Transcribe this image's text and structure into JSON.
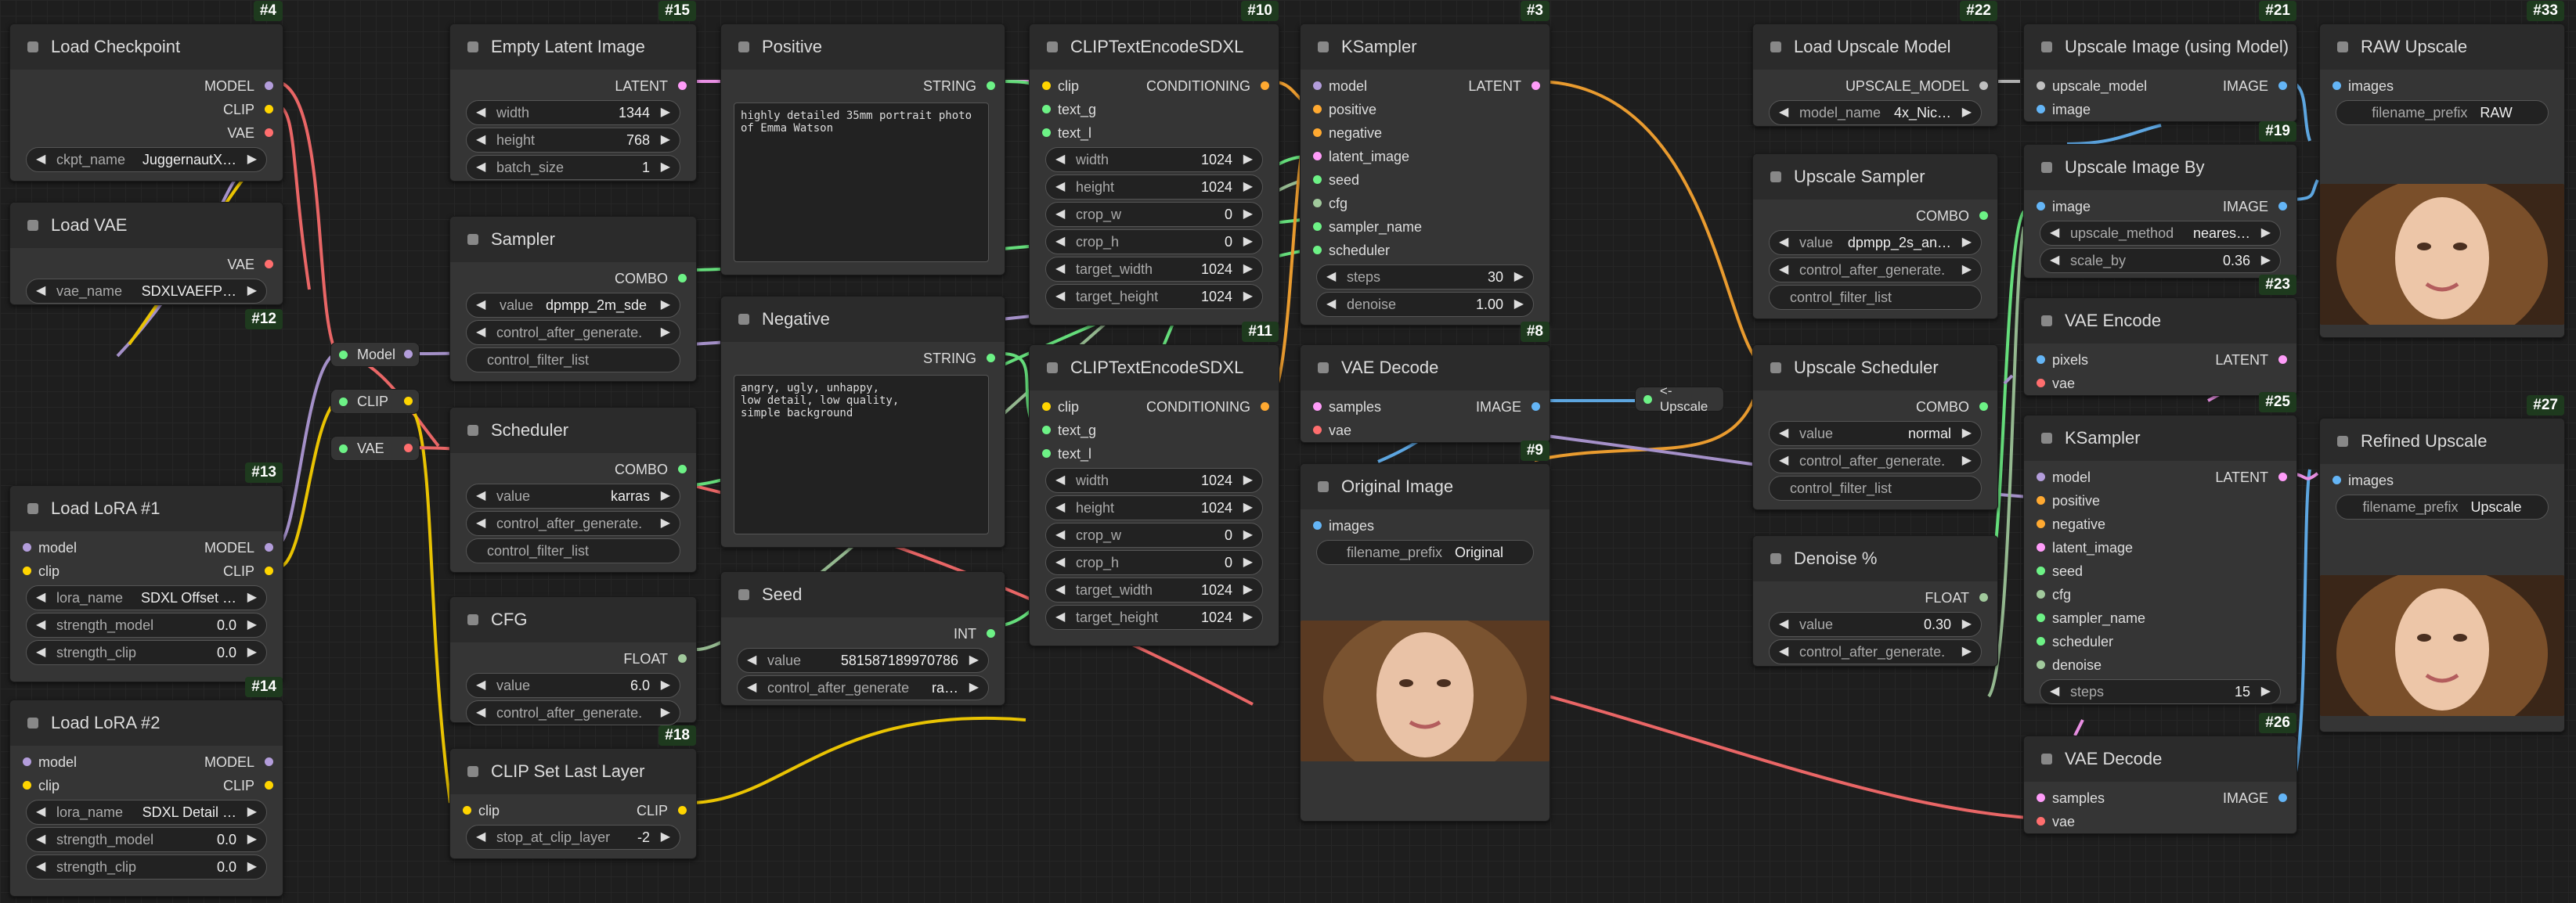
{
  "colors": {
    "model": "#b39ddb",
    "clip": "#ffd500",
    "vae": "#ff6e6e",
    "latent": "#ff9cf9",
    "conditioning": "#ffa931",
    "image": "#64b5f6",
    "string": "#6df286",
    "int": "#6df286",
    "float": "#a1c99c",
    "combo": "#6df286",
    "upscale": "#c0c0c0"
  },
  "nodes": {
    "n4": {
      "title": "Load Checkpoint",
      "id": "#4",
      "out": [
        "MODEL",
        "CLIP",
        "VAE"
      ],
      "w": {
        "label": "ckpt_name",
        "value": "JuggernautX…"
      }
    },
    "n12": {
      "title": "Load VAE",
      "id": "#12",
      "out": [
        "VAE"
      ],
      "w": {
        "label": "vae_name",
        "value": "SDXLVAEFP…"
      }
    },
    "n13": {
      "title": "Load LoRA #1",
      "id": "#13",
      "in": [
        "model",
        "clip"
      ],
      "out": [
        "MODEL",
        "CLIP"
      ],
      "w": [
        {
          "label": "lora_name",
          "value": "SDXL Offset …"
        },
        {
          "label": "strength_model",
          "value": "0.0"
        },
        {
          "label": "strength_clip",
          "value": "0.0"
        }
      ]
    },
    "n14": {
      "title": "Load LoRA #2",
      "id": "#14",
      "in": [
        "model",
        "clip"
      ],
      "out": [
        "MODEL",
        "CLIP"
      ],
      "w": [
        {
          "label": "lora_name",
          "value": "SDXL Detail …"
        },
        {
          "label": "strength_model",
          "value": "0.0"
        },
        {
          "label": "strength_clip",
          "value": "0.0"
        }
      ]
    },
    "r_model": "Model",
    "r_clip": "CLIP",
    "r_vae": "VAE",
    "n15": {
      "title": "Empty Latent Image",
      "id": "#15",
      "out": [
        "LATENT"
      ],
      "w": [
        {
          "label": "width",
          "value": "1344"
        },
        {
          "label": "height",
          "value": "768"
        },
        {
          "label": "batch_size",
          "value": "1"
        }
      ]
    },
    "sampler": {
      "title": "Sampler",
      "out": [
        "COMBO"
      ],
      "w": [
        {
          "label": "value",
          "value": "dpmpp_2m_sde"
        },
        {
          "label": "control_after_generate.",
          "value": ""
        },
        {
          "label": "control_filter_list",
          "value": ""
        }
      ]
    },
    "scheduler": {
      "title": "Scheduler",
      "out": [
        "COMBO"
      ],
      "w": [
        {
          "label": "value",
          "value": "karras"
        },
        {
          "label": "control_after_generate.",
          "value": ""
        },
        {
          "label": "control_filter_list",
          "value": ""
        }
      ]
    },
    "cfg": {
      "title": "CFG",
      "out": [
        "FLOAT"
      ],
      "w": [
        {
          "label": "value",
          "value": "6.0"
        },
        {
          "label": "control_after_generate.",
          "value": ""
        }
      ]
    },
    "n18": {
      "title": "CLIP Set Last Layer",
      "id": "#18",
      "in": [
        "clip"
      ],
      "out": [
        "CLIP"
      ],
      "w": {
        "label": "stop_at_clip_layer",
        "value": "-2"
      }
    },
    "positive": {
      "title": "Positive",
      "out": [
        "STRING"
      ],
      "text": "highly detailed 35mm portrait photo of Emma Watson"
    },
    "negative": {
      "title": "Negative",
      "out": [
        "STRING"
      ],
      "text": "angry, ugly, unhappy,\nlow detail, low quality,\nsimple background"
    },
    "seed": {
      "title": "Seed",
      "out": [
        "INT"
      ],
      "w": [
        {
          "label": "value",
          "value": "581587189970786"
        },
        {
          "label": "control_after_generate",
          "value": "ra…"
        }
      ]
    },
    "n10": {
      "title": "CLIPTextEncodeSDXL",
      "id": "#10",
      "in": [
        "clip",
        "text_g",
        "text_l"
      ],
      "out": [
        "CONDITIONING"
      ],
      "w": [
        {
          "label": "width",
          "value": "1024"
        },
        {
          "label": "height",
          "value": "1024"
        },
        {
          "label": "crop_w",
          "value": "0"
        },
        {
          "label": "crop_h",
          "value": "0"
        },
        {
          "label": "target_width",
          "value": "1024"
        },
        {
          "label": "target_height",
          "value": "1024"
        }
      ]
    },
    "n11": {
      "title": "CLIPTextEncodeSDXL",
      "id": "#11",
      "in": [
        "clip",
        "text_g",
        "text_l"
      ],
      "out": [
        "CONDITIONING"
      ],
      "w": [
        {
          "label": "width",
          "value": "1024"
        },
        {
          "label": "height",
          "value": "1024"
        },
        {
          "label": "crop_w",
          "value": "0"
        },
        {
          "label": "crop_h",
          "value": "0"
        },
        {
          "label": "target_width",
          "value": "1024"
        },
        {
          "label": "target_height",
          "value": "1024"
        }
      ]
    },
    "n3": {
      "title": "KSampler",
      "id": "#3",
      "in": [
        "model",
        "positive",
        "negative",
        "latent_image",
        "seed",
        "cfg",
        "sampler_name",
        "scheduler"
      ],
      "out": [
        "LATENT"
      ],
      "w": [
        {
          "label": "steps",
          "value": "30"
        },
        {
          "label": "denoise",
          "value": "1.00"
        }
      ]
    },
    "n8": {
      "title": "VAE Decode",
      "id": "#8",
      "in": [
        "samples",
        "vae"
      ],
      "out": [
        "IMAGE"
      ]
    },
    "n9": {
      "title": "Original Image",
      "id": "#9",
      "in": [
        "images"
      ],
      "w": {
        "label": "filename_prefix",
        "value": "Original"
      }
    },
    "n22": {
      "title": "Load Upscale Model",
      "id": "#22",
      "out": [
        "UPSCALE_MODEL"
      ],
      "w": {
        "label": "model_name",
        "value": "4x_Nic…"
      }
    },
    "upsampler": {
      "title": "Upscale Sampler",
      "out": [
        "COMBO"
      ],
      "w": [
        {
          "label": "value",
          "value": "dpmpp_2s_an…"
        },
        {
          "label": "control_after_generate.",
          "value": ""
        },
        {
          "label": "control_filter_list",
          "value": ""
        }
      ]
    },
    "upsched": {
      "title": "Upscale Scheduler",
      "out": [
        "COMBO"
      ],
      "w": [
        {
          "label": "value",
          "value": "normal"
        },
        {
          "label": "control_after_generate.",
          "value": ""
        },
        {
          "label": "control_filter_list",
          "value": ""
        }
      ]
    },
    "denoise": {
      "title": "Denoise %",
      "out": [
        "FLOAT"
      ],
      "w": [
        {
          "label": "value",
          "value": "0.30"
        },
        {
          "label": "control_after_generate.",
          "value": ""
        }
      ]
    },
    "r_ups": "<- Upscale",
    "n21": {
      "title": "Upscale Image (using Model)",
      "id": "#21",
      "in": [
        "upscale_model",
        "image"
      ],
      "out": [
        "IMAGE"
      ]
    },
    "n19": {
      "title": "Upscale Image By",
      "id": "#19",
      "in": [
        "image"
      ],
      "out": [
        "IMAGE"
      ],
      "w": [
        {
          "label": "upscale_method",
          "value": "neares…"
        },
        {
          "label": "scale_by",
          "value": "0.36"
        }
      ]
    },
    "n23": {
      "title": "VAE Encode",
      "id": "#23",
      "in": [
        "pixels",
        "vae"
      ],
      "out": [
        "LATENT"
      ]
    },
    "n25": {
      "title": "KSampler",
      "id": "#25",
      "in": [
        "model",
        "positive",
        "negative",
        "latent_image",
        "seed",
        "cfg",
        "sampler_name",
        "scheduler",
        "denoise"
      ],
      "out": [
        "LATENT"
      ],
      "w": {
        "label": "steps",
        "value": "15"
      }
    },
    "n26": {
      "title": "VAE Decode",
      "id": "#26",
      "in": [
        "samples",
        "vae"
      ],
      "out": [
        "IMAGE"
      ]
    },
    "n33": {
      "title": "RAW Upscale",
      "id": "#33",
      "in": [
        "images"
      ],
      "w": {
        "label": "filename_prefix",
        "value": "RAW"
      }
    },
    "n27": {
      "title": "Refined Upscale",
      "id": "#27",
      "in": [
        "images"
      ],
      "w": {
        "label": "filename_prefix",
        "value": "Upscale"
      }
    }
  }
}
